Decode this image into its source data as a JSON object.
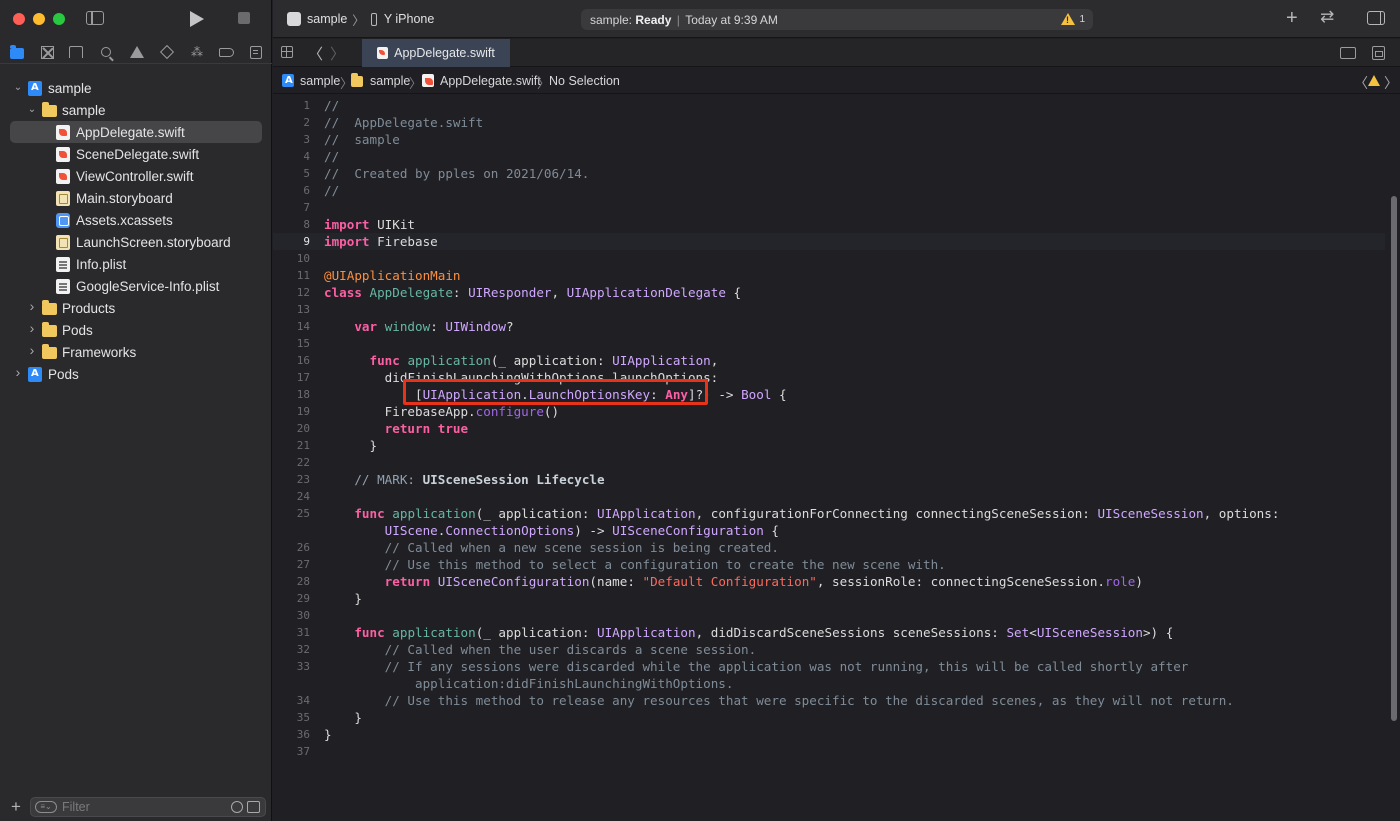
{
  "sidebar": {
    "filter_placeholder": "Filter",
    "tree": [
      {
        "label": "sample",
        "depth": 0,
        "icon": "project",
        "expanded": true
      },
      {
        "label": "sample",
        "depth": 1,
        "icon": "folder",
        "expanded": true
      },
      {
        "label": "AppDelegate.swift",
        "depth": 2,
        "icon": "swift",
        "selected": true
      },
      {
        "label": "SceneDelegate.swift",
        "depth": 2,
        "icon": "swift"
      },
      {
        "label": "ViewController.swift",
        "depth": 2,
        "icon": "swift"
      },
      {
        "label": "Main.storyboard",
        "depth": 2,
        "icon": "storyboard"
      },
      {
        "label": "Assets.xcassets",
        "depth": 2,
        "icon": "assets"
      },
      {
        "label": "LaunchScreen.storyboard",
        "depth": 2,
        "icon": "storyboard"
      },
      {
        "label": "Info.plist",
        "depth": 2,
        "icon": "plist"
      },
      {
        "label": "GoogleService-Info.plist",
        "depth": 2,
        "icon": "plist"
      },
      {
        "label": "Products",
        "depth": 1,
        "icon": "folder",
        "expanded": false
      },
      {
        "label": "Pods",
        "depth": 1,
        "icon": "folder",
        "expanded": false
      },
      {
        "label": "Frameworks",
        "depth": 1,
        "icon": "folder",
        "expanded": false
      },
      {
        "label": "Pods",
        "depth": 0,
        "icon": "project",
        "expanded": false
      }
    ]
  },
  "toolbar": {
    "scheme": "sample",
    "destination": "Y iPhone",
    "status_prefix": "sample: ",
    "status_state": "Ready",
    "status_time": "Today at 9:39 AM",
    "warning_count": "1"
  },
  "tab": {
    "label": "AppDelegate.swift"
  },
  "jumpbar": {
    "items": [
      "sample",
      "sample",
      "AppDelegate.swift",
      "No Selection"
    ]
  },
  "editor": {
    "current_line": 9,
    "lines": [
      {
        "n": "1",
        "html": "<span class=\"cm\">//</span>"
      },
      {
        "n": "2",
        "html": "<span class=\"cm\">//  AppDelegate.swift</span>"
      },
      {
        "n": "3",
        "html": "<span class=\"cm\">//  sample</span>"
      },
      {
        "n": "4",
        "html": "<span class=\"cm\">//</span>"
      },
      {
        "n": "5",
        "html": "<span class=\"cm\">//  Created by pples on 2021/06/14.</span>"
      },
      {
        "n": "6",
        "html": "<span class=\"cm\">//</span>"
      },
      {
        "n": "7",
        "html": ""
      },
      {
        "n": "8",
        "html": "<span class=\"kw\">import</span> UIKit"
      },
      {
        "n": "9",
        "html": "<span class=\"kw\">import</span> Firebase"
      },
      {
        "n": "10",
        "html": ""
      },
      {
        "n": "11",
        "html": "<span class=\"attr\">@UIApplicationMain</span>"
      },
      {
        "n": "12",
        "html": "<span class=\"kw\">class</span> <span class=\"fn\">AppDelegate</span>: <span class=\"ty\">UIResponder</span>, <span class=\"ty\">UIApplicationDelegate</span> {"
      },
      {
        "n": "13",
        "html": ""
      },
      {
        "n": "14",
        "html": "    <span class=\"kw\">var</span> <span class=\"fn\">window</span>: <span class=\"ty\">UIWindow</span>?"
      },
      {
        "n": "15",
        "html": ""
      },
      {
        "n": "16",
        "html": "      <span class=\"kw\">func</span> <span class=\"fn\">application</span>(_ application: <span class=\"ty\">UIApplication</span>,"
      },
      {
        "n": "17",
        "html": "        didFinishLaunchingWithOptions launchOptions:"
      },
      {
        "n": "18",
        "html": "            [<span class=\"ty\">UIApplication</span>.<span class=\"ty\">LaunchOptionsKey</span>: <span class=\"kw\">Any</span>]?) -> <span class=\"ty\">Bool</span> {"
      },
      {
        "n": "19",
        "html": "        FirebaseApp.<span class=\"prop\">configure</span>()"
      },
      {
        "n": "20",
        "html": "        <span class=\"kw\">return</span> <span class=\"kw\">true</span>"
      },
      {
        "n": "21",
        "html": "      }"
      },
      {
        "n": "22",
        "html": ""
      },
      {
        "n": "23",
        "html": "    <span class=\"mark\">// MARK: </span><span class=\"mark\" style=\"font-weight:bold;color:#c9d1d9\">UISceneSession Lifecycle</span>"
      },
      {
        "n": "24",
        "html": ""
      },
      {
        "n": "25",
        "html": "    <span class=\"kw\">func</span> <span class=\"fn\">application</span>(_ application: <span class=\"ty\">UIApplication</span>, configurationForConnecting connectingSceneSession: <span class=\"ty\">UISceneSession</span>, options:"
      },
      {
        "n": "",
        "html": "        <span class=\"ty\">UIScene</span>.<span class=\"ty\">ConnectionOptions</span>) -> <span class=\"ty\">UISceneConfiguration</span> {"
      },
      {
        "n": "26",
        "html": "        <span class=\"cm\">// Called when a new scene session is being created.</span>"
      },
      {
        "n": "27",
        "html": "        <span class=\"cm\">// Use this method to select a configuration to create the new scene with.</span>"
      },
      {
        "n": "28",
        "html": "        <span class=\"kw\">return</span> <span class=\"ty\">UISceneConfiguration</span>(name: <span class=\"str\">\"Default Configuration\"</span>, sessionRole: connectingSceneSession.<span class=\"prop\">role</span>)"
      },
      {
        "n": "29",
        "html": "    }"
      },
      {
        "n": "30",
        "html": ""
      },
      {
        "n": "31",
        "html": "    <span class=\"kw\">func</span> <span class=\"fn\">application</span>(_ application: <span class=\"ty\">UIApplication</span>, didDiscardSceneSessions sceneSessions: <span class=\"ty\">Set</span>&lt;<span class=\"ty\">UISceneSession</span>&gt;) {"
      },
      {
        "n": "32",
        "html": "        <span class=\"cm\">// Called when the user discards a scene session.</span>"
      },
      {
        "n": "33",
        "html": "        <span class=\"cm\">// If any sessions were discarded while the application was not running, this will be called shortly after</span>"
      },
      {
        "n": "",
        "html": "            <span class=\"cm\">application:didFinishLaunchingWithOptions.</span>"
      },
      {
        "n": "34",
        "html": "        <span class=\"cm\">// Use this method to release any resources that were specific to the discarded scenes, as they will not return.</span>"
      },
      {
        "n": "35",
        "html": "    }"
      },
      {
        "n": "36",
        "html": "}"
      },
      {
        "n": "37",
        "html": ""
      }
    ]
  },
  "colors": {
    "accent": "#2e8af7",
    "annotation_box": "#e8321a",
    "keyword": "#fc5fa3",
    "comment": "#7f8c98",
    "type": "#d0a8ff"
  }
}
